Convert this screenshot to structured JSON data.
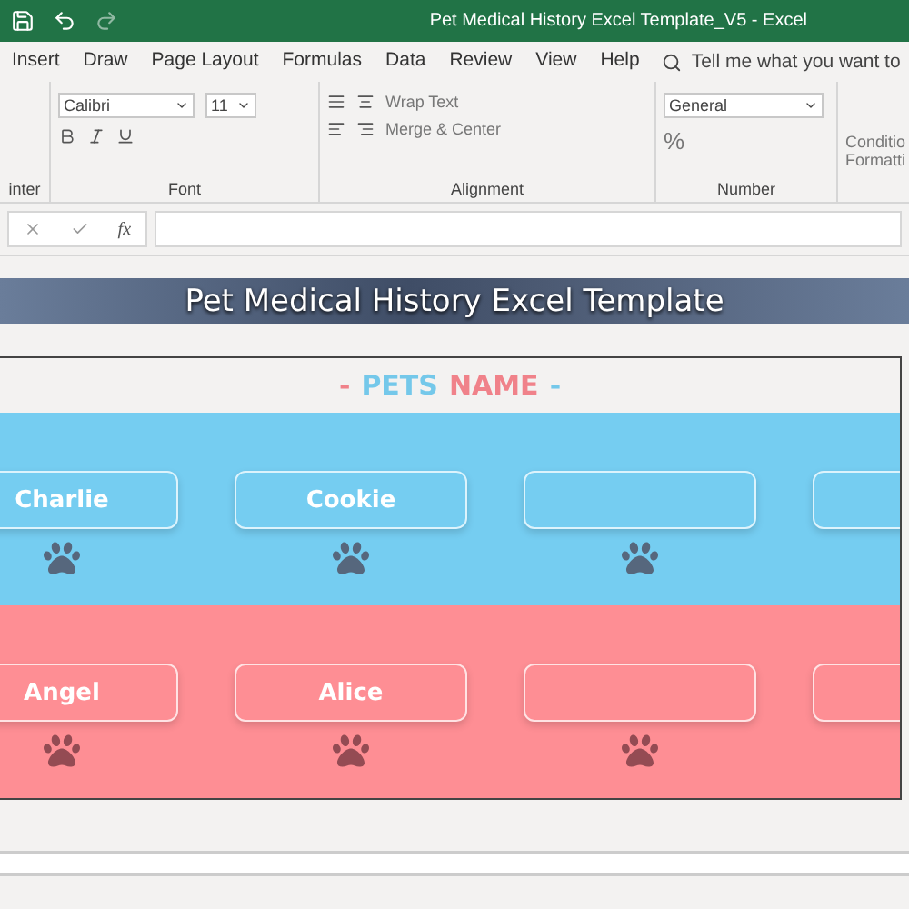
{
  "window": {
    "title": "Pet Medical History Excel Template_V5  -  Excel"
  },
  "ribbon_tabs": [
    {
      "label": "Insert",
      "selected": false
    },
    {
      "label": "Draw",
      "selected": false
    },
    {
      "label": "Page Layout",
      "selected": false
    },
    {
      "label": "Formulas",
      "selected": false
    },
    {
      "label": "Data",
      "selected": false
    },
    {
      "label": "Review",
      "selected": false
    },
    {
      "label": "View",
      "selected": false
    },
    {
      "label": "Help",
      "selected": false
    }
  ],
  "tell_me": {
    "placeholder": "Tell me what you want to"
  },
  "ribbon": {
    "clipboard_label": "inter",
    "font_name": "Calibri",
    "font_size": "11",
    "font_group": "Font",
    "wrap_text": "Wrap Text",
    "merge_center": "Merge & Center",
    "alignment_group": "Alignment",
    "number_format": "General",
    "percent": "%",
    "number_group": "Number",
    "conditional": [
      "Conditio",
      "Formatti"
    ]
  },
  "formula_bar": {
    "function_label": "fx"
  },
  "sheet": {
    "banner": "Pet Medical History Excel Template",
    "heading": [
      {
        "text": "-",
        "color": "#f0828a"
      },
      {
        "text": "PETS",
        "color": "#74c8ea"
      },
      {
        "text": "NAME",
        "color": "#f0828a"
      },
      {
        "text": "-",
        "color": "#74c8ea"
      }
    ],
    "bands": [
      {
        "color": "#75cdf1",
        "pets": [
          {
            "kind": "named",
            "name": "Charlie"
          },
          {
            "kind": "named",
            "name": "Cookie"
          },
          {
            "kind": "empty"
          },
          {
            "kind": "empty"
          }
        ]
      },
      {
        "color": "#fe8e94",
        "pets": [
          {
            "kind": "named",
            "name": "Angel"
          },
          {
            "kind": "named",
            "name": "Alice"
          },
          {
            "kind": "empty"
          },
          {
            "kind": "empty"
          }
        ]
      }
    ]
  }
}
